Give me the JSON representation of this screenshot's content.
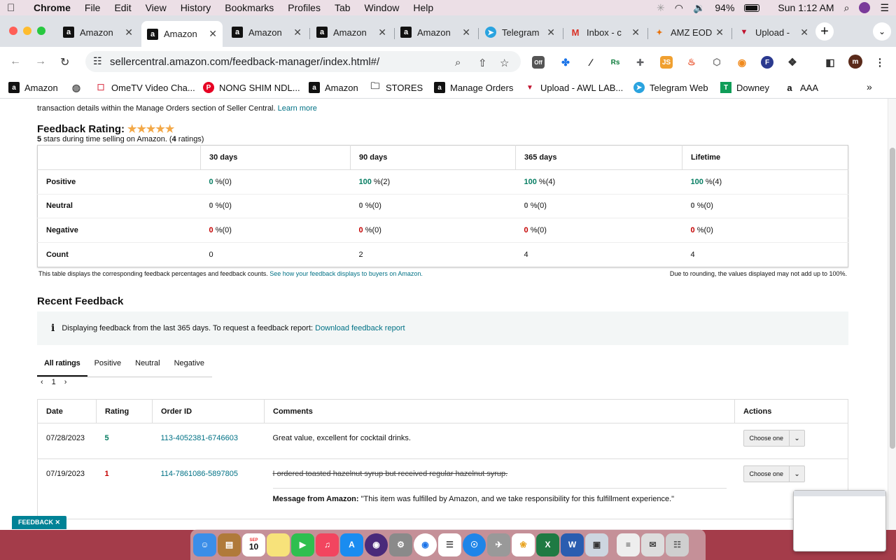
{
  "menubar": {
    "app": "Chrome",
    "items": [
      "File",
      "Edit",
      "View",
      "History",
      "Bookmarks",
      "Profiles",
      "Tab",
      "Window",
      "Help"
    ],
    "battery": "94%",
    "clock": "Sun 1:12 AM"
  },
  "tabs": [
    {
      "label": "Amazon"
    },
    {
      "label": "Amazon"
    },
    {
      "label": "Amazon"
    },
    {
      "label": "Amazon"
    },
    {
      "label": "Amazon"
    },
    {
      "label": "Telegram"
    },
    {
      "label": "Inbox - c"
    },
    {
      "label": "AMZ EOD"
    },
    {
      "label": "Upload -"
    }
  ],
  "address": {
    "url": "sellercentral.amazon.com/feedback-manager/index.html#/"
  },
  "bookmarks": [
    {
      "label": "Amazon"
    },
    {
      "label": ""
    },
    {
      "label": "OmeTV Video Cha..."
    },
    {
      "label": "NONG SHIM NDL..."
    },
    {
      "label": "Amazon"
    },
    {
      "label": "STORES"
    },
    {
      "label": "Manage Orders"
    },
    {
      "label": "Upload - AWL LAB..."
    },
    {
      "label": "Telegram Web"
    },
    {
      "label": "Downey"
    },
    {
      "label": "AAA"
    }
  ],
  "page": {
    "intro_text": "transaction details within the Manage Orders section of Seller Central.",
    "intro_link": "Learn more",
    "rating_title": "Feedback Rating:",
    "rating_stars": 5,
    "rating_sub_stars": "5",
    "rating_sub_text1": " stars during time selling on Amazon. (",
    "rating_sub_count": "4",
    "rating_sub_text2": " ratings)",
    "summary": {
      "headers": [
        "30 days",
        "90 days",
        "365 days",
        "Lifetime"
      ],
      "positive_label": "Positive",
      "neutral_label": "Neutral",
      "negative_label": "Negative",
      "count_label": "Count",
      "positive": [
        {
          "pct": "0",
          "n": "%(0)"
        },
        {
          "pct": "100",
          "n": "%(2)"
        },
        {
          "pct": "100",
          "n": "%(4)"
        },
        {
          "pct": "100",
          "n": "%(4)"
        }
      ],
      "neutral": [
        {
          "pct": "0",
          "n": "%(0)"
        },
        {
          "pct": "0",
          "n": "%(0)"
        },
        {
          "pct": "0",
          "n": "%(0)"
        },
        {
          "pct": "0",
          "n": "%(0)"
        }
      ],
      "negative": [
        {
          "pct": "0",
          "n": "%(0)"
        },
        {
          "pct": "0",
          "n": "%(0)"
        },
        {
          "pct": "0",
          "n": "%(0)"
        },
        {
          "pct": "0",
          "n": "%(0)"
        }
      ],
      "count": [
        "0",
        "2",
        "4",
        "4"
      ]
    },
    "table_note": "This table displays the corresponding feedback percentages and feedback counts.",
    "table_note_link": "See how your feedback displays to buyers on Amazon.",
    "rounding_note": "Due to rounding, the values displayed may not add up to 100%.",
    "recent_title": "Recent Feedback",
    "info_text": "Displaying feedback from the last 365 days. To request a feedback report:",
    "info_link": "Download feedback report",
    "filter_tabs": [
      "All ratings",
      "Positive",
      "Neutral",
      "Negative"
    ],
    "page_number": "1",
    "feedback_headers": [
      "Date",
      "Rating",
      "Order ID",
      "Comments",
      "Actions"
    ],
    "feedback_rows": [
      {
        "date": "07/28/2023",
        "rating": "5",
        "order": "113-4052381-6746603",
        "comment": "Great value, excellent for cocktail drinks.",
        "action": "Choose one"
      },
      {
        "date": "07/19/2023",
        "rating": "1",
        "order": "114-7861086-5897805",
        "comment": "I ordered toasted hazelnut syrup but received regular hazelnut syrup.",
        "msg_label": "Message from Amazon:",
        "msg_text": "\"This item was fulfilled by Amazon, and we take responsibility for this fulfillment experience.\"",
        "action": "Choose one"
      }
    ],
    "feedback_pill": "FEEDBACK"
  },
  "dock": {
    "calendar_month": "SEP",
    "calendar_day": "10"
  },
  "colors": {
    "link": "#007185",
    "positive": "#067d62",
    "negative": "#c40000",
    "star": "#f3a847"
  }
}
